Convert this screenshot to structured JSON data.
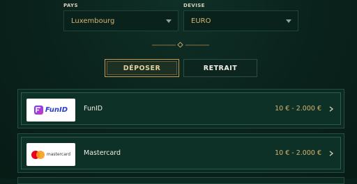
{
  "country": {
    "label": "PAYS",
    "value": "Luxembourg"
  },
  "currency": {
    "label": "DEVISE",
    "value": "EURO"
  },
  "tabs": [
    {
      "label": "DÉPOSER",
      "active": true
    },
    {
      "label": "RETRAIT",
      "active": false
    }
  ],
  "methods": [
    {
      "name": "FunID",
      "logo_text": "FunID",
      "range": "10 € - 2.000 €"
    },
    {
      "name": "Mastercard",
      "logo_text": "mastercard",
      "range": "10 € - 2.000 €"
    }
  ],
  "colors": {
    "accent_gold": "#d9b46f",
    "background": "#0a221c",
    "card_border": "#2f5c4c"
  }
}
